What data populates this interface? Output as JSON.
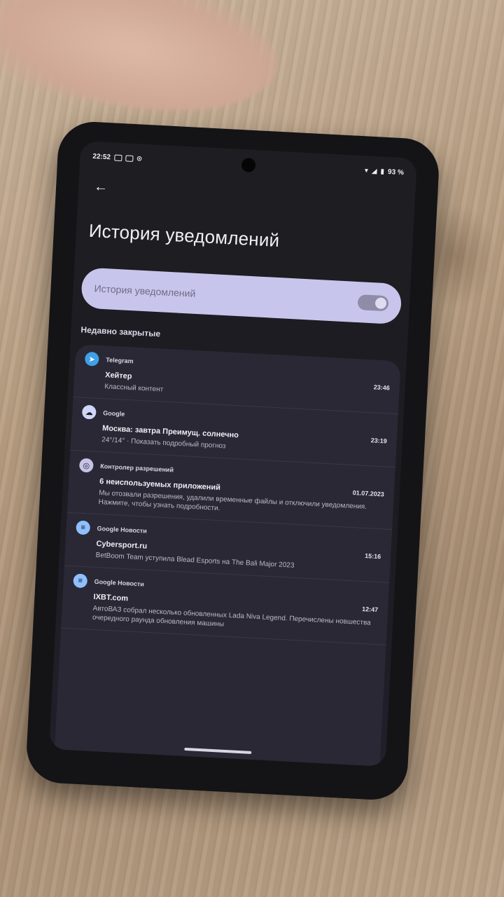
{
  "status_bar": {
    "time": "22:52",
    "battery": "93 %"
  },
  "header": {
    "back_icon": "arrow-left-icon",
    "title": "История уведомлений"
  },
  "toggle": {
    "label": "История уведомлений",
    "state": "on"
  },
  "section": {
    "heading": "Недавно закрытые"
  },
  "colors": {
    "toggle_card": "#c8c5ec",
    "list_bg": "#2a2834",
    "telegram": "#3fa0e8",
    "google": "#cfd6f8",
    "permissions": "#c6c3e6",
    "news": "#8ec0ff"
  },
  "notifications": [
    {
      "app": "Telegram",
      "icon": "telegram-icon",
      "time": "23:46",
      "title": "Хейтер",
      "text": "Классный контент"
    },
    {
      "app": "Google",
      "icon": "cloud-icon",
      "time": "23:19",
      "title": "Москва: завтра Преимущ. солнечно",
      "text": "24°/14° · Показать подробный прогноз"
    },
    {
      "app": "Контролер разрешений",
      "icon": "permissions-icon",
      "time": "01.07.2023",
      "title": "6 неиспользуемых приложений",
      "text": "Мы отозвали разрешения, удалили временные файлы и отключили уведомления. Нажмите, чтобы узнать подробности."
    },
    {
      "app": "Google Новости",
      "icon": "news-icon",
      "time": "15:16",
      "title": "Cybersport.ru",
      "text": "BetBoom Team уступила Blead Esports на The Bali Major 2023"
    },
    {
      "app": "Google Новости",
      "icon": "news-icon",
      "time": "12:47",
      "title": "IXBT.com",
      "text": "АвтоВАЗ собрал несколько обновленных Lada Niva Legend. Перечислены новшества очередного раунда обновления машины"
    }
  ]
}
